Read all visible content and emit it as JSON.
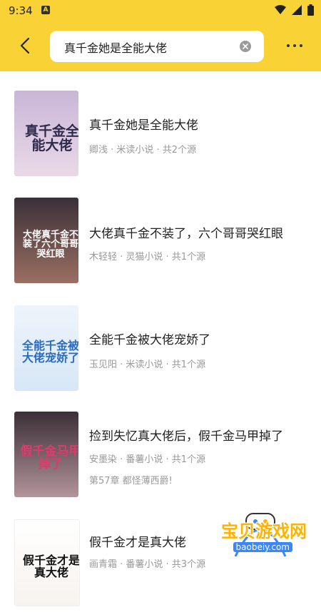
{
  "status_bar": {
    "time": "9:34",
    "notif_glyph": "A"
  },
  "header": {
    "search_query": "真千金她是全能大佬",
    "back_icon": "back-arrow-icon",
    "more_icon": "more-dots-icon",
    "clear_icon": "clear-icon"
  },
  "results": [
    {
      "title": "真千金她是全能大佬",
      "meta": "卿浅 · 米读小说 · 共2个源",
      "cover_text": "真千金全能大佬",
      "cover_colors": [
        "#c9b6d8",
        "#e9d9e7"
      ]
    },
    {
      "title": "大佬真千金不装了，六个哥哥哭红眼",
      "meta": "木轻轻 · 灵猫小说 · 共1个源",
      "cover_text": "大佬真千金不装了六个哥哥哭红眼",
      "cover_colors": [
        "#3a3038",
        "#9b6f62"
      ]
    },
    {
      "title": "全能千金被大佬宠娇了",
      "meta": "玉见阳 · 米读小说 · 共1个源",
      "cover_text": "全能千金被大佬宠娇了",
      "cover_colors": [
        "#eef4fb",
        "#d7e7f7"
      ]
    },
    {
      "title": "捡到失忆真大佬后，假千金马甲掉了",
      "meta": "安墨染 · 番薯小说 · 共1个源",
      "chapter": "第57章 都怪薄西爵!",
      "cover_text": "假千金马甲掉了",
      "cover_colors": [
        "#3c2f37",
        "#b2949a"
      ]
    },
    {
      "title": "假千金才是真大佬",
      "meta": "画青霜 · 番薯小说 · 共3个源",
      "cover_text": "假千金才是真大佬",
      "cover_colors": [
        "#ffffff",
        "#f7f3ef"
      ]
    }
  ],
  "watermark": {
    "title": "宝贝游戏网",
    "url": "baobeiy.com"
  },
  "colors": {
    "header_bg": "#f9d236",
    "title": "#222222",
    "meta": "#999999"
  }
}
